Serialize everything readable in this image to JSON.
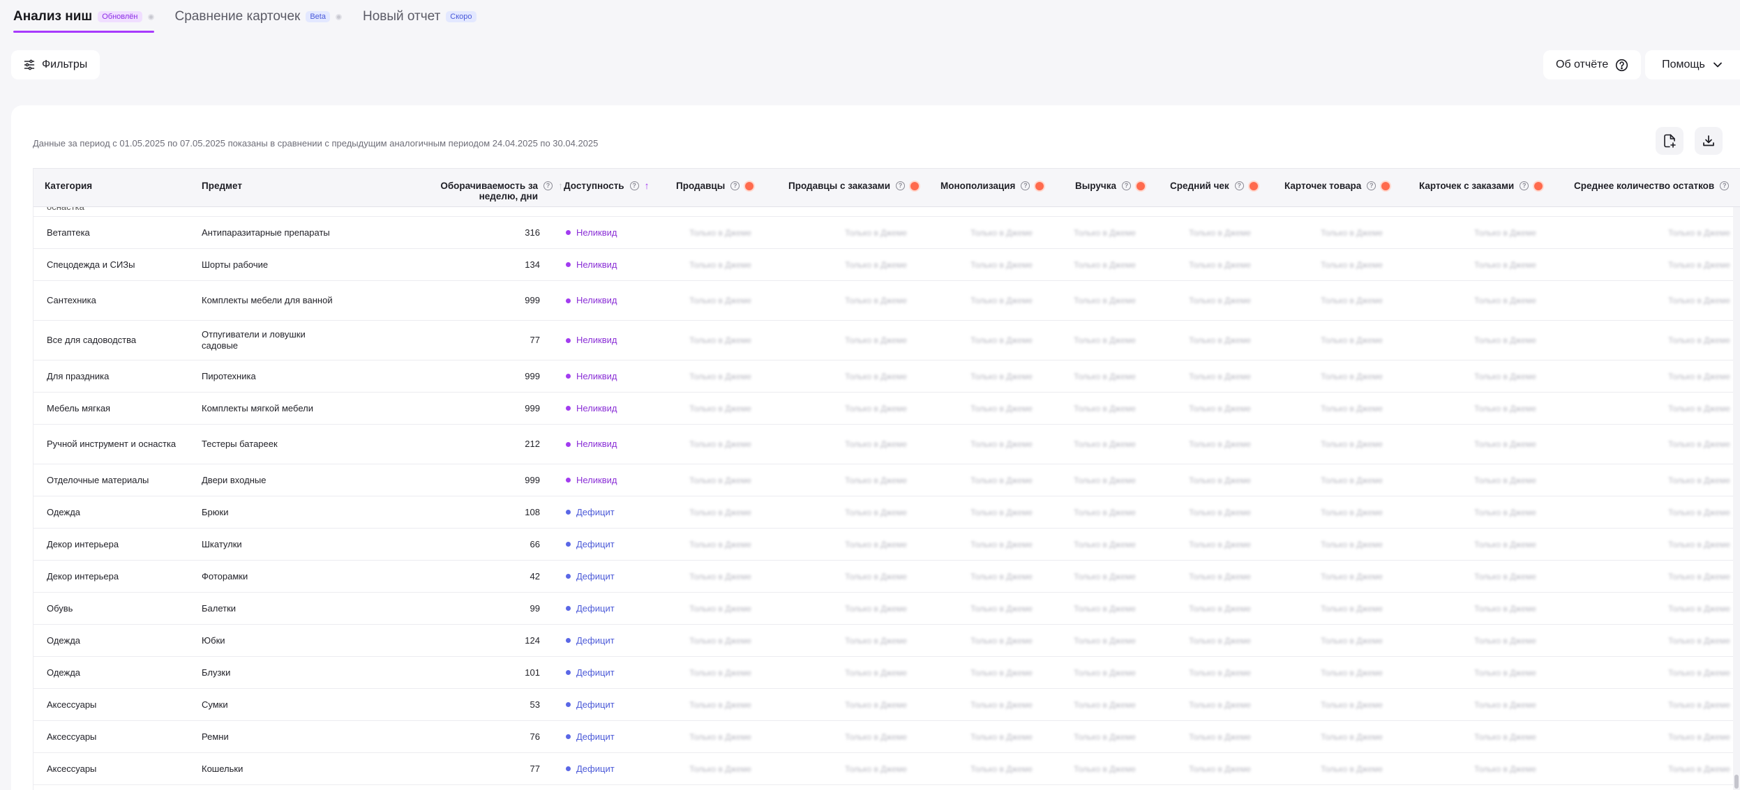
{
  "tabs": [
    {
      "label": "Анализ ниш",
      "badge": "Обновлён",
      "badge_color": "purple",
      "active": true,
      "dot": true
    },
    {
      "label": "Сравнение карточек",
      "badge": "Beta",
      "badge_color": "blue",
      "active": false,
      "dot": true
    },
    {
      "label": "Новый отчет",
      "badge": "Скоро",
      "badge_color": "blue",
      "active": false,
      "dot": false
    }
  ],
  "toolbar": {
    "filters_label": "Фильтры",
    "about_label": "Об отчёте",
    "help_label": "Помощь"
  },
  "period_text": "Данные за период с 01.05.2025 по 07.05.2025 показаны в сравнении с предыдущим аналогичным периодом 24.04.2025 по 30.04.2025",
  "table": {
    "columns": {
      "category": "Категория",
      "subject": "Предмет",
      "turnover": "Оборачиваемость за неделю, дни",
      "availability": "Доступность",
      "sellers": "Продавцы",
      "sellers_with_orders": "Продавцы с заказами",
      "monopolization": "Монополизация",
      "revenue": "Выручка",
      "avg_check": "Средний чек",
      "cards": "Карточек товара",
      "cards_with_orders": "Карточек с заказами",
      "avg_stock": "Среднее количество остатков"
    },
    "locked_placeholder": "Только в Джеме",
    "partial_top_row": "оснастка",
    "rows": [
      {
        "category": "Ветаптека",
        "subject": "Антипаразитарные препараты",
        "turnover": "316",
        "availability": "Неликвид",
        "status": "neliq"
      },
      {
        "category": "Спецодежда и СИЗы",
        "subject": "Шорты рабочие",
        "turnover": "134",
        "availability": "Неликвид",
        "status": "neliq"
      },
      {
        "category": "Сантехника",
        "subject": "Комплекты мебели для ванной",
        "turnover": "999",
        "availability": "Неликвид",
        "status": "neliq"
      },
      {
        "category": "Все для садоводства",
        "subject": "Отпугиватели и ловушки садовые",
        "turnover": "77",
        "availability": "Неликвид",
        "status": "neliq"
      },
      {
        "category": "Для праздника",
        "subject": "Пиротехника",
        "turnover": "999",
        "availability": "Неликвид",
        "status": "neliq"
      },
      {
        "category": "Мебель мягкая",
        "subject": "Комплекты мягкой мебели",
        "turnover": "999",
        "availability": "Неликвид",
        "status": "neliq"
      },
      {
        "category": "Ручной инструмент и оснастка",
        "subject": "Тестеры батареек",
        "turnover": "212",
        "availability": "Неликвид",
        "status": "neliq"
      },
      {
        "category": "Отделочные материалы",
        "subject": "Двери входные",
        "turnover": "999",
        "availability": "Неликвид",
        "status": "neliq"
      },
      {
        "category": "Одежда",
        "subject": "Брюки",
        "turnover": "108",
        "availability": "Дефицит",
        "status": "deficit"
      },
      {
        "category": "Декор интерьера",
        "subject": "Шкатулки",
        "turnover": "66",
        "availability": "Дефицит",
        "status": "deficit"
      },
      {
        "category": "Декор интерьера",
        "subject": "Фоторамки",
        "turnover": "42",
        "availability": "Дефицит",
        "status": "deficit"
      },
      {
        "category": "Обувь",
        "subject": "Балетки",
        "turnover": "99",
        "availability": "Дефицит",
        "status": "deficit"
      },
      {
        "category": "Одежда",
        "subject": "Юбки",
        "turnover": "124",
        "availability": "Дефицит",
        "status": "deficit"
      },
      {
        "category": "Одежда",
        "subject": "Блузки",
        "turnover": "101",
        "availability": "Дефицит",
        "status": "deficit"
      },
      {
        "category": "Аксессуары",
        "subject": "Сумки",
        "turnover": "53",
        "availability": "Дефицит",
        "status": "deficit"
      },
      {
        "category": "Аксессуары",
        "subject": "Ремни",
        "turnover": "76",
        "availability": "Дефицит",
        "status": "deficit"
      },
      {
        "category": "Аксессуары",
        "subject": "Кошельки",
        "turnover": "77",
        "availability": "Дефицит",
        "status": "deficit"
      }
    ]
  }
}
